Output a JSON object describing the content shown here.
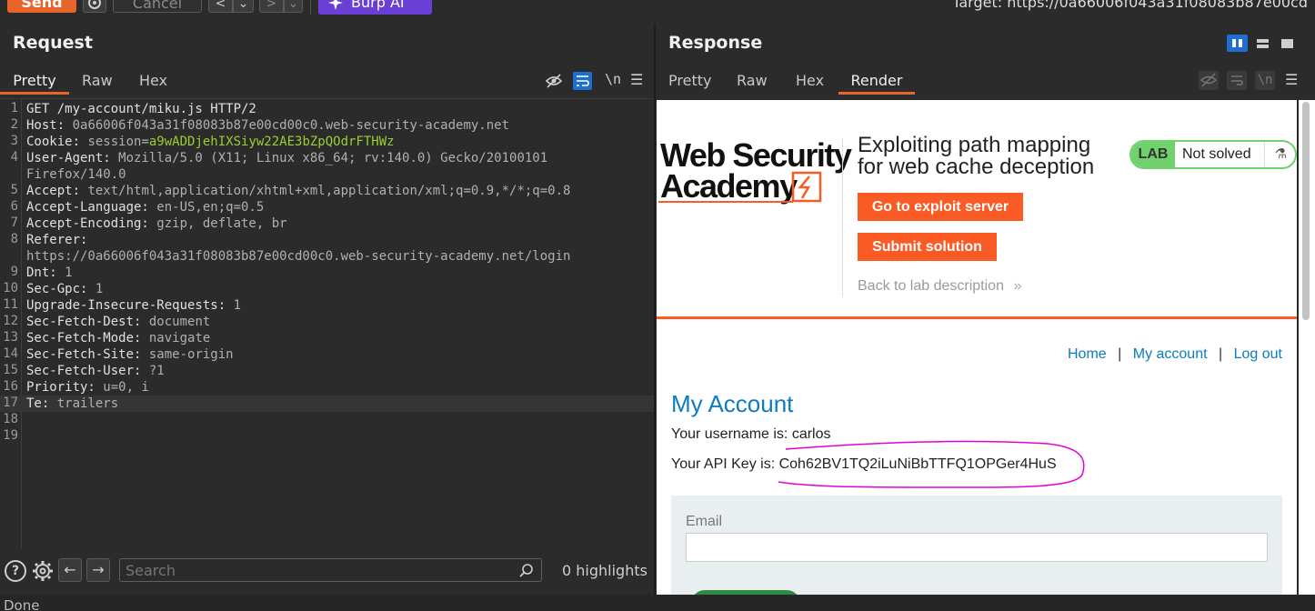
{
  "toolbar": {
    "send_label": "Send",
    "cancel_label": "Cancel",
    "prev_label": "<",
    "prev_menu_label": "⌄",
    "next_label": ">",
    "next_menu_label": "⌄",
    "burp_ai_label": "Burp AI",
    "target_text": "Target: https://0a66006f043a31f08083b87e00cd"
  },
  "request": {
    "title": "Request",
    "tabs": [
      "Pretty",
      "Raw",
      "Hex"
    ],
    "active_tab": "Pretty",
    "newline_toggle": "\\n",
    "lines": [
      {
        "n": "1",
        "name": "GET /my-account/miku.js HTTP/2",
        "value": ""
      },
      {
        "n": "2",
        "name": "Host:",
        "value": " 0a66006f043a31f08083b87e00cd00c0.web-security-academy.net"
      },
      {
        "n": "3",
        "name": "Cookie:",
        "value": " session=",
        "cookie": "a9wADDjehIXSiyw22AE3bZpQOdrFTHWz"
      },
      {
        "n": "4",
        "name": "User-Agent:",
        "value": " Mozilla/5.0 (X11; Linux x86_64; rv:140.0) Gecko/20100101"
      },
      {
        "n": "",
        "name": "",
        "value": "Firefox/140.0"
      },
      {
        "n": "5",
        "name": "Accept:",
        "value": " text/html,application/xhtml+xml,application/xml;q=0.9,*/*;q=0.8"
      },
      {
        "n": "6",
        "name": "Accept-Language:",
        "value": " en-US,en;q=0.5"
      },
      {
        "n": "7",
        "name": "Accept-Encoding:",
        "value": " gzip, deflate, br"
      },
      {
        "n": "8",
        "name": "Referer:",
        "value": ""
      },
      {
        "n": "",
        "name": "",
        "value": "https://0a66006f043a31f08083b87e00cd00c0.web-security-academy.net/login"
      },
      {
        "n": "9",
        "name": "Dnt:",
        "value": " 1"
      },
      {
        "n": "10",
        "name": "Sec-Gpc:",
        "value": " 1"
      },
      {
        "n": "11",
        "name": "Upgrade-Insecure-Requests:",
        "value": " 1"
      },
      {
        "n": "12",
        "name": "Sec-Fetch-Dest:",
        "value": " document"
      },
      {
        "n": "13",
        "name": "Sec-Fetch-Mode:",
        "value": " navigate"
      },
      {
        "n": "14",
        "name": "Sec-Fetch-Site:",
        "value": " same-origin"
      },
      {
        "n": "15",
        "name": "Sec-Fetch-User:",
        "value": " ?1"
      },
      {
        "n": "16",
        "name": "Priority:",
        "value": " u=0, i"
      },
      {
        "n": "17",
        "name": "Te:",
        "value": " trailers"
      },
      {
        "n": "18",
        "name": "",
        "value": ""
      },
      {
        "n": "19",
        "name": "",
        "value": ""
      }
    ]
  },
  "search": {
    "placeholder": "Search",
    "highlights": "0 highlights"
  },
  "response": {
    "title": "Response",
    "tabs": [
      "Pretty",
      "Raw",
      "Hex",
      "Render"
    ],
    "active_tab": "Render",
    "newline_toggle": "\\n"
  },
  "lab": {
    "logo_line1": "Web Security",
    "logo_line2": "Academy",
    "title_line1": "Exploiting path mapping",
    "title_line2": "for web cache deception",
    "exploit_button": "Go to exploit server",
    "submit_button": "Submit solution",
    "back_link": "Back to lab description",
    "badge_lab": "LAB",
    "badge_status": "Not solved",
    "nav_home": "Home",
    "nav_account": "My account",
    "nav_logout": "Log out",
    "nav_sep": "|",
    "heading": "My Account",
    "username_line": "Your username is: carlos",
    "api_key_prefix": "Your API Key is: ",
    "api_key": "Coh62BV1TQ2iLuNiBbTTFQ1OPGer4HuS",
    "email_label": "Email"
  },
  "status": {
    "text": "Done"
  },
  "colors": {
    "accent": "#e8642b",
    "burp_ai": "#6a3fd6",
    "cookie_value": "#9acd32",
    "lab_orange": "#fa5a23",
    "link_blue": "#0c7bc0",
    "badge_green": "#70d16d",
    "annotation": "#e600d6"
  }
}
